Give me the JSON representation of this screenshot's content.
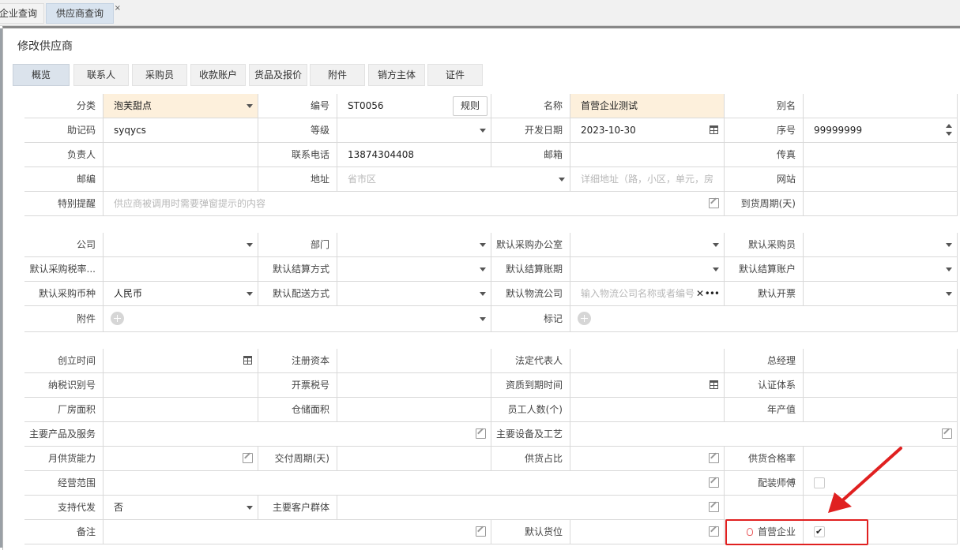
{
  "top_tabs": [
    "企业查询",
    "供应商查询"
  ],
  "close_glyph": "×",
  "window_title": "修改供应商",
  "tabs": [
    "概览",
    "联系人",
    "采购员",
    "收款账户",
    "货品及报价",
    "附件",
    "销方主体",
    "证件"
  ],
  "basic": {
    "category_label": "分类",
    "category_value": "泡芙甜点",
    "code_label": "编号",
    "code_value": "ST0056",
    "rule_button": "规则",
    "name_label": "名称",
    "name_value": "首营企业测试",
    "alias_label": "别名",
    "mnemonic_label": "助记码",
    "mnemonic_value": "syqycs",
    "level_label": "等级",
    "dev_date_label": "开发日期",
    "dev_date_value": "2023-10-30",
    "seq_label": "序号",
    "seq_value": "99999999",
    "owner_label": "负责人",
    "phone_label": "联系电话",
    "phone_value": "13874304408",
    "email_label": "邮箱",
    "fax_label": "传真",
    "zip_label": "邮编",
    "address_label": "地址",
    "address_region_placeholder": "省市区",
    "address_detail_placeholder": "详细地址（路，小区，单元，房",
    "website_label": "网站",
    "reminder_label": "特别提醒",
    "reminder_placeholder": "供应商被调用时需要弹窗提示的内容",
    "delivery_cycle_label": "到货周期(天)"
  },
  "purchase": {
    "company_label": "公司",
    "dept_label": "部门",
    "office_label": "默认采购办公室",
    "buyer_label": "默认采购员",
    "tax_label": "默认采购税率...",
    "settle_method_label": "默认结算方式",
    "settle_period_label": "默认结算账期",
    "settle_account_label": "默认结算账户",
    "currency_label": "默认采购币种",
    "currency_value": "人民币",
    "delivery_method_label": "默认配送方式",
    "logistics_label": "默认物流公司",
    "logistics_placeholder": "输入物流公司名称或者编号",
    "invoice_label": "默认开票",
    "attachment_label": "附件",
    "tag_label": "标记"
  },
  "company": {
    "founded_label": "创立时间",
    "capital_label": "注册资本",
    "legal_rep_label": "法定代表人",
    "gm_label": "总经理",
    "taxpayer_label": "纳税识别号",
    "invoice_tax_label": "开票税号",
    "qual_expiry_label": "资质到期时间",
    "cert_label": "认证体系",
    "plant_label": "厂房面积",
    "warehouse_label": "仓储面积",
    "staff_label": "员工人数(个)",
    "output_label": "年产值",
    "products_label": "主要产品及服务",
    "equipment_label": "主要设备及工艺",
    "monthly_label": "月供货能力",
    "delivery_cycle_label": "交付周期(天)",
    "supply_ratio_label": "供货占比",
    "pass_rate_label": "供货合格率",
    "scope_label": "经营范围",
    "installer_label": "配装师傅",
    "dropship_label": "支持代发",
    "dropship_value": "否",
    "customers_label": "主要客户群体",
    "remark_label": "备注",
    "location_label": "默认货位",
    "first_label": "首营企业"
  },
  "colors": {
    "highlight": "#fdf0dc",
    "annotation": "#e02020",
    "active_tab": "#dbe3ec"
  },
  "first_checked": true
}
